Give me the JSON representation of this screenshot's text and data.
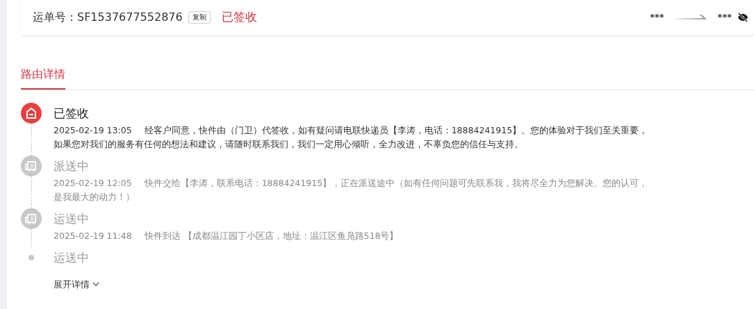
{
  "waybill": {
    "label": "运单号：",
    "number": "SF1537677552876",
    "copy_button": "复制",
    "status": "已签收",
    "sender": "***",
    "receiver": "***"
  },
  "tabs": [
    {
      "label": "路由详情",
      "selected": true
    }
  ],
  "events": [
    {
      "kind": "signed",
      "active": true,
      "title": "已签收",
      "time": "2025-02-19 13:05",
      "text": "经客户同意，快件由（门卫）代签收，如有疑问请电联快递员【李涛，电话：18884241915】。您的体验对于我们至关重要，如果您对我们的服务有任何的想法和建议，请随时联系我们，我们一定用心倾听，全力改进，不辜负您的信任与支持。"
    },
    {
      "kind": "truck",
      "active": false,
      "title": "派送中",
      "time": "2025-02-19 12:05",
      "text": "快件交给【李涛，联系电话：18884241915】，正在派送途中（如有任何问题可先联系我，我将尽全力为您解决。您的认可，是我最大的动力！）"
    },
    {
      "kind": "truck",
      "active": false,
      "title": "运送中",
      "time": "2025-02-19 11:48",
      "text": "快件到达 【成都温江园丁小区店，地址：温江区鱼凫路518号】"
    },
    {
      "kind": "dot",
      "active": false,
      "title": "运送中"
    }
  ],
  "expand_link": "展开详情"
}
